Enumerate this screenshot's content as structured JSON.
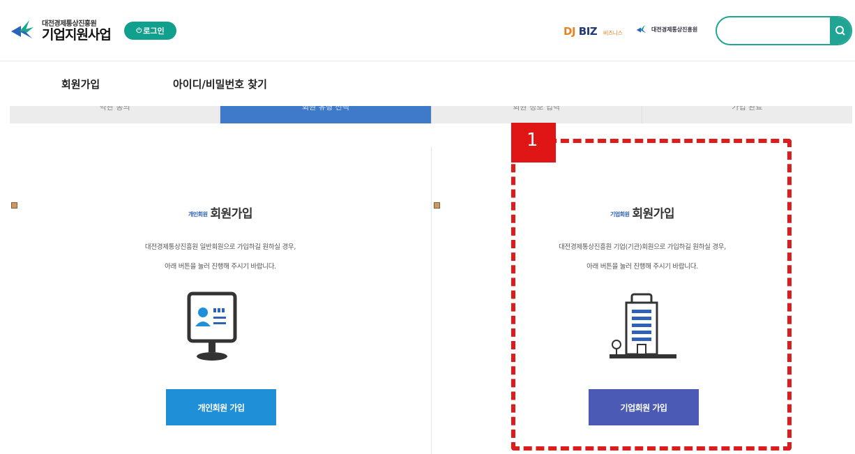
{
  "header": {
    "logo_sub": "대전경제통상진흥원",
    "logo_main": "기업지원사업",
    "login_label": "로그인",
    "djbiz_dj": "DJ",
    "djbiz_biz": "BIZ",
    "djbiz_small": "비즈니스",
    "agency_name": "대전경제통상진흥원",
    "search": {
      "placeholder": "",
      "value": ""
    },
    "colors": {
      "accent": "#11a08d",
      "search_border": "#20a595"
    }
  },
  "subnav": {
    "items": [
      {
        "label": "회원가입"
      },
      {
        "label": "아이디/비밀번호 찾기"
      }
    ]
  },
  "tabs": [
    {
      "label": "약관 동의",
      "active": false
    },
    {
      "label": "회원 유형 선택",
      "active": true
    },
    {
      "label": "회원 정보 입력",
      "active": false
    },
    {
      "label": "가입 완료",
      "active": false
    }
  ],
  "panels": {
    "personal": {
      "tag": "개인회원",
      "title": "회원가입",
      "desc_line1": "대전경제통상진흥원 일반회원으로 가입하길 원하실 경우,",
      "desc_line2": "아래 버튼을 눌러 진행해 주시기 바랍니다.",
      "button_label": "개인회원 가입",
      "icon": "monitor-user-icon",
      "color": "#1f8fd8"
    },
    "corporate": {
      "tag": "기업회원",
      "title": "회원가입",
      "desc_line1": "대전경제통상진흥원 기업(기관)회원으로 가입하길 원하실 경우,",
      "desc_line2": "아래 버튼을 눌러 진행해 주시기 바랍니다.",
      "button_label": "기업회원 가입",
      "icon": "building-icon",
      "color": "#4b5ab4"
    }
  },
  "annotation": {
    "number": "1",
    "color": "#dd1d1d"
  }
}
